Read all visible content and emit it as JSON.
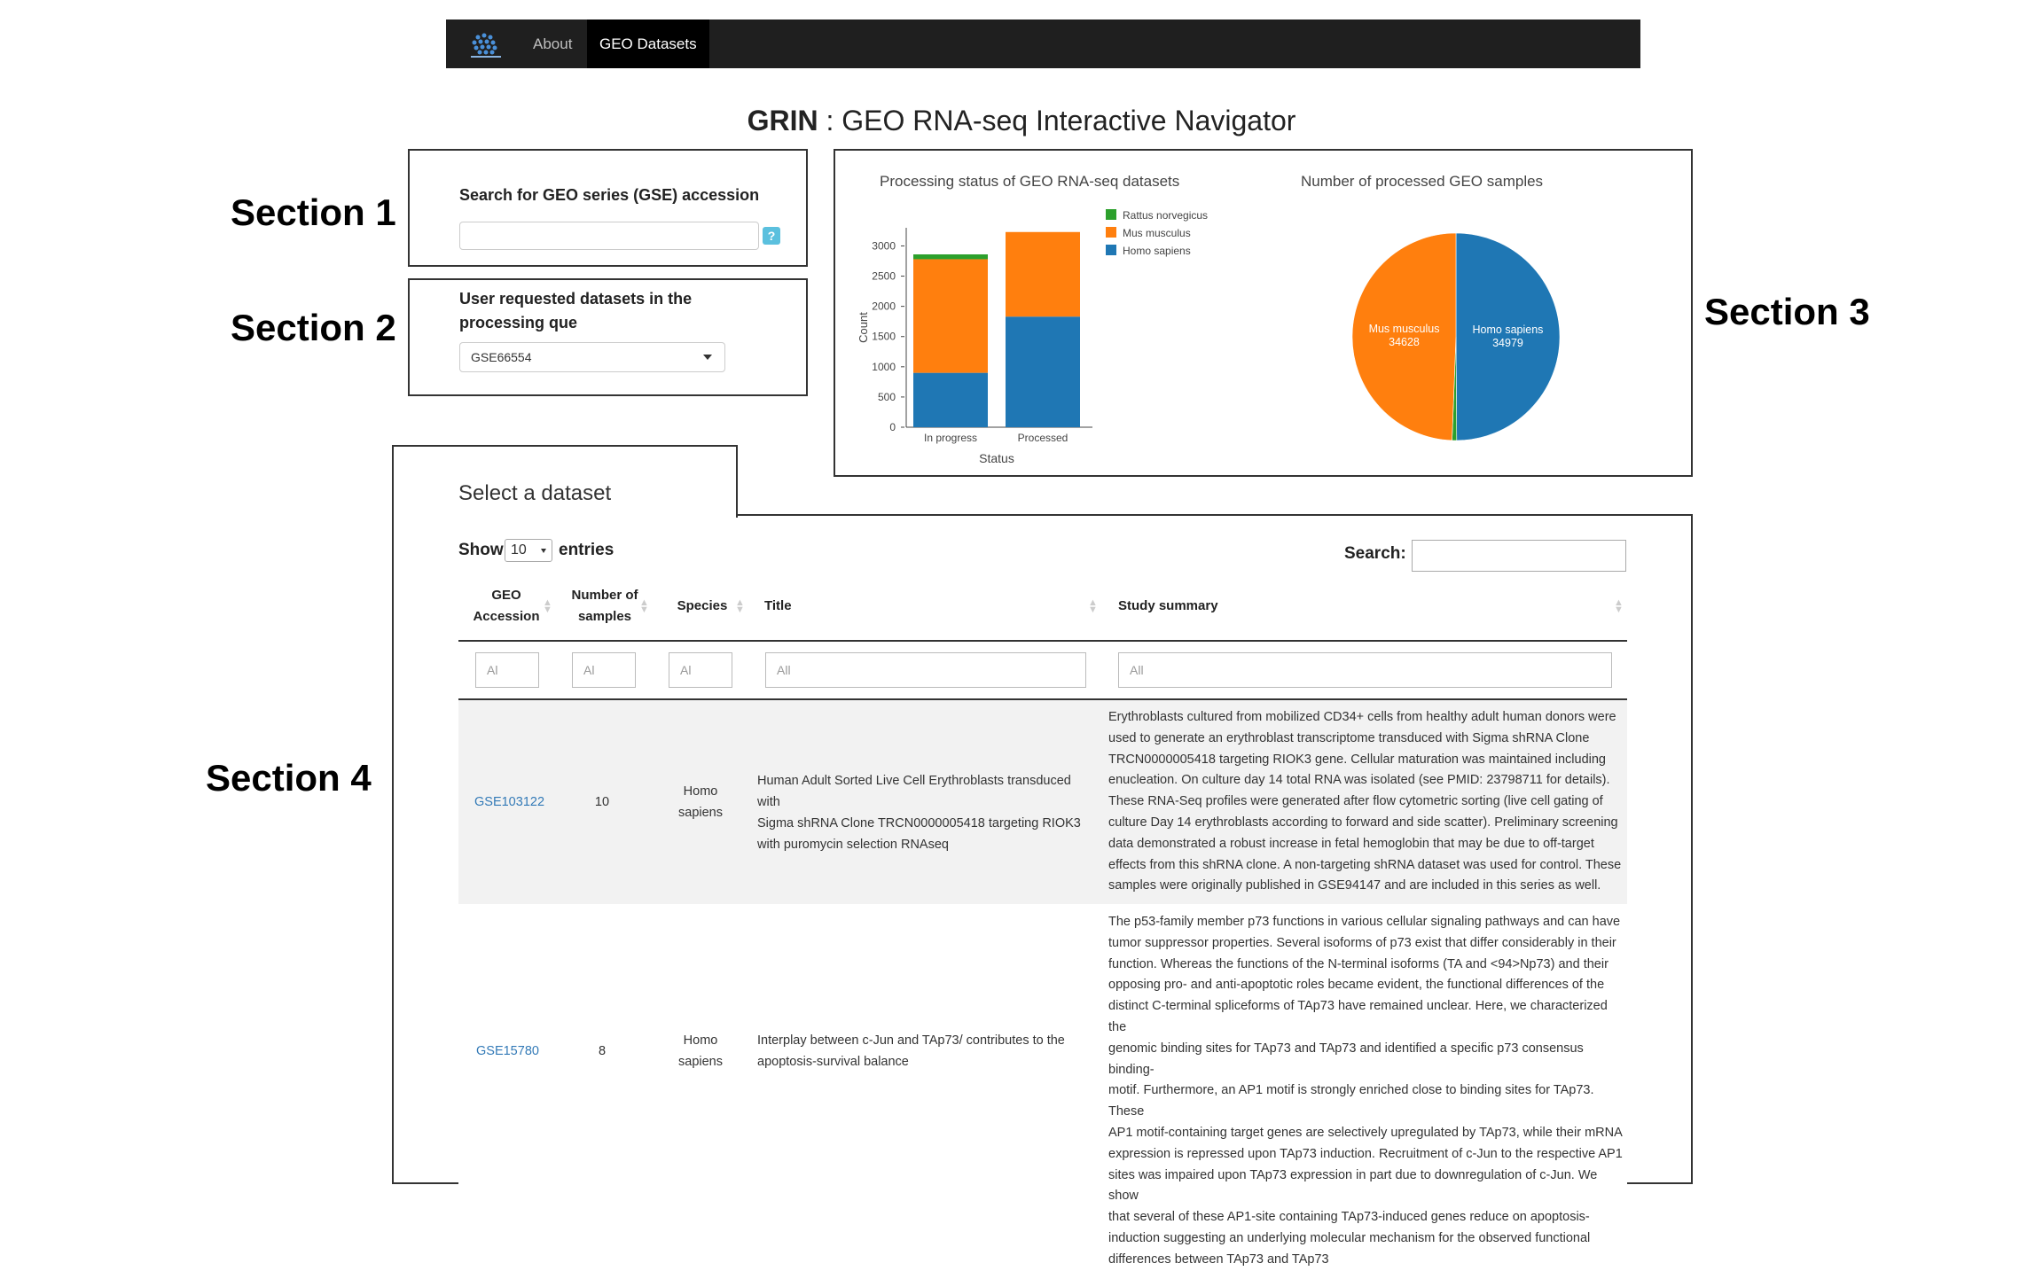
{
  "navbar": {
    "about_label": "About",
    "geo_label": "GEO Datasets"
  },
  "page_title": {
    "bold": "GRIN",
    "rest": " : GEO RNA-seq Interactive Navigator"
  },
  "sections": {
    "s1": "Section 1",
    "s2": "Section 2",
    "s3": "Section 3",
    "s4": "Section 4"
  },
  "section1": {
    "label": "Search for GEO series (GSE) accession",
    "help": "?"
  },
  "section2": {
    "label": "User requested datasets in the processing que",
    "selected": "GSE66554"
  },
  "chart_data": [
    {
      "type": "bar",
      "title": "Processing status of GEO RNA-seq datasets",
      "xlabel": "Status",
      "ylabel": "Count",
      "categories": [
        "In progress",
        "Processed"
      ],
      "yticks": [
        0,
        500,
        1000,
        1500,
        2000,
        2500,
        3000
      ],
      "ylim": [
        0,
        3300
      ],
      "stacked": true,
      "series": [
        {
          "name": "Homo sapiens",
          "color": "#1f77b4",
          "values": [
            900,
            1830
          ]
        },
        {
          "name": "Mus musculus",
          "color": "#ff7f0e",
          "values": [
            1880,
            1400
          ]
        },
        {
          "name": "Rattus norvegicus",
          "color": "#2ca02c",
          "values": [
            80,
            0
          ]
        }
      ],
      "legend_order": [
        "Rattus norvegicus",
        "Mus musculus",
        "Homo sapiens"
      ],
      "legend": "right"
    },
    {
      "type": "pie",
      "title": "Number of processed GEO samples",
      "slices": [
        {
          "name": "Homo sapiens",
          "value": 34979,
          "label_lines": [
            "Homo sapiens",
            "34979"
          ],
          "color": "#1f77b4"
        },
        {
          "name": "Rattus norvegicus",
          "value": 500,
          "label_lines": [],
          "color": "#2ca02c"
        },
        {
          "name": "Mus musculus",
          "value": 34628,
          "label_lines": [
            "Mus musculus",
            "34628"
          ],
          "color": "#ff7f0e"
        }
      ]
    }
  ],
  "section4": {
    "title": "Select a dataset",
    "show": "Show",
    "entries_value": "10",
    "entries": "entries",
    "search_label": "Search:",
    "columns": [
      {
        "line1": "GEO",
        "line2": "Accession"
      },
      {
        "line1": "Number of",
        "line2": "samples"
      },
      {
        "line1": "Species",
        "line2": ""
      },
      {
        "line1": "Title",
        "line2": ""
      },
      {
        "line1": "Study summary",
        "line2": ""
      }
    ],
    "filters": [
      "Al",
      "Al",
      "Al",
      "All",
      "All"
    ],
    "rows": [
      {
        "accession": "GSE103122",
        "samples": "10",
        "species": [
          "Homo",
          "sapiens"
        ],
        "title": [
          "Human Adult Sorted Live Cell Erythroblasts transduced with",
          "Sigma shRNA Clone TRCN0000005418 targeting RIOK3",
          "with puromycin selection RNAseq"
        ],
        "summary": [
          "Erythroblasts cultured from mobilized CD34+ cells from healthy adult human donors were",
          "used to generate an erythroblast transcriptome transduced with Sigma shRNA Clone",
          "TRCN0000005418 targeting RIOK3 gene. Cellular maturation was maintained including",
          "enucleation. On culture day 14 total RNA was isolated (see PMID: 23798711 for details).",
          "These RNA-Seq profiles were generated after flow cytometric sorting (live cell gating of",
          "culture Day 14 erythroblasts according to forward and side scatter). Preliminary screening",
          "data demonstrated a robust increase in fetal hemoglobin that may be due to off-target",
          "effects from this shRNA clone. A non-targeting shRNA dataset was used for control. These",
          "samples were originally published in GSE94147 and are included in this series as well."
        ]
      },
      {
        "accession": "GSE15780",
        "samples": "8",
        "species": [
          "Homo",
          "sapiens"
        ],
        "title": [
          "Interplay between c-Jun and TAp73/ contributes to the",
          "apoptosis-survival balance"
        ],
        "summary": [
          "The p53-family member p73 functions in various cellular signaling pathways and can have",
          "tumor suppressor properties. Several isoforms of p73 exist that differ considerably in their",
          "function. Whereas the functions of the N-terminal isoforms (TA and <94>Np73) and their",
          "opposing pro- and anti-apoptotic roles became evident, the functional differences of the",
          "distinct C-terminal spliceforms of TAp73 have remained unclear. Here, we characterized the",
          "genomic binding sites for TAp73 and TAp73 and identified a specific p73 consensus binding-",
          "motif. Furthermore, an AP1 motif is strongly enriched close to binding sites for TAp73. These",
          "AP1 motif-containing target genes are selectively upregulated by TAp73, while their mRNA",
          "expression is repressed upon TAp73 induction. Recruitment of c-Jun to the respective AP1",
          "sites was impaired upon TAp73 expression in part due to downregulation of c-Jun. We show",
          "that several of these AP1-site containing TAp73-induced genes reduce on apoptosis-",
          "induction suggesting an underlying molecular mechanism for the observed functional",
          "differences between TAp73 and TAp73"
        ]
      }
    ]
  }
}
